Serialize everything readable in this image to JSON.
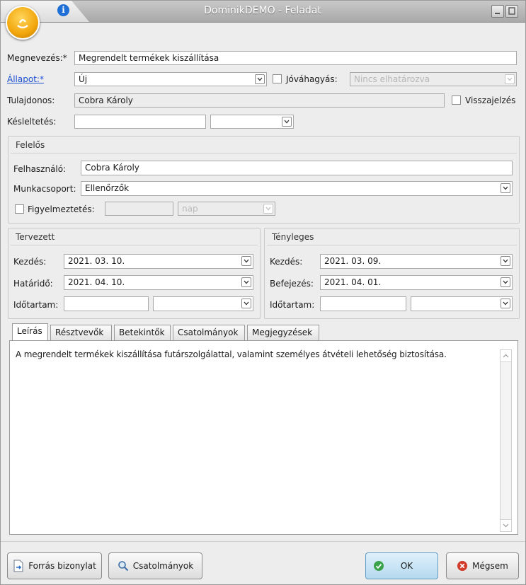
{
  "window": {
    "title": "DominikDEMO - Feladat"
  },
  "form": {
    "name_label": "Megnevezés:*",
    "name_value": "Megrendelt termékek kiszállítása",
    "status_label": "Állapot:*",
    "status_value": "Új",
    "approval_label": "Jóváhagyás:",
    "approval_value": "Nincs elhatározva",
    "owner_label": "Tulajdonos:",
    "owner_value": "Cobra Károly",
    "feedback_label": "Visszajelzés",
    "delay_label": "Késleltetés:",
    "delay_value": "",
    "delay_unit": ""
  },
  "responsible": {
    "title": "Felelős",
    "user_label": "Felhasználó:",
    "user_value": "Cobra Károly",
    "group_label": "Munkacsoport:",
    "group_value": "Ellenőrzők",
    "warning_label": "Figyelmeztetés:",
    "warning_value": "",
    "warning_unit": "nap"
  },
  "planned": {
    "title": "Tervezett",
    "start_label": "Kezdés:",
    "start_value": "2021. 03. 10.",
    "deadline_label": "Határidő:",
    "deadline_value": "2021. 04. 10.",
    "duration_label": "Időtartam:",
    "duration_value": "",
    "duration_unit": ""
  },
  "actual": {
    "title": "Tényleges",
    "start_label": "Kezdés:",
    "start_value": "2021. 03. 09.",
    "finish_label": "Befejezés:",
    "finish_value": "2021. 04. 01.",
    "duration_label": "Időtartam:",
    "duration_value": "",
    "duration_unit": ""
  },
  "tabs": [
    "Leírás",
    "Résztvevők",
    "Betekintők",
    "Csatolmányok",
    "Megjegyzések"
  ],
  "description": "A megrendelt termékek kiszállítása futárszolgálattal, valamint személyes átvételi lehetőség biztosítása.",
  "buttons": {
    "source": "Forrás bizonylat",
    "attachments": "Csatolmányok",
    "ok": "OK",
    "cancel": "Mégsem"
  },
  "colors": {
    "accent": "#1e6fd6",
    "app_icon": "#f2a60c",
    "cancel_icon": "#d23b2a",
    "ok_icon": "#3aa34a"
  }
}
